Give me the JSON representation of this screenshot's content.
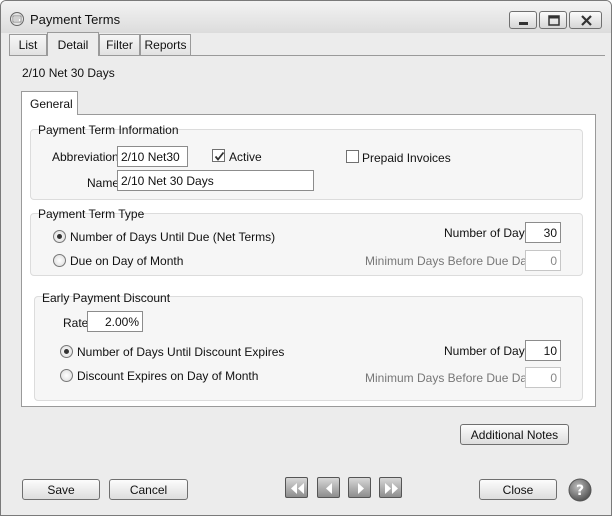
{
  "window": {
    "title": "Payment Terms"
  },
  "tabs": [
    {
      "label": "List"
    },
    {
      "label": "Detail"
    },
    {
      "label": "Filter"
    },
    {
      "label": "Reports"
    }
  ],
  "record_title": "2/10 Net 30 Days",
  "inner_tabs": [
    {
      "label": "General"
    }
  ],
  "payment_term_information": {
    "title": "Payment Term Information",
    "abbreviation_label": "Abbreviation",
    "abbreviation_value": "2/10 Net30",
    "active_label": "Active",
    "active_checked": true,
    "prepaid_label": "Prepaid Invoices",
    "prepaid_checked": false,
    "name_label": "Name",
    "name_value": "2/10 Net 30 Days"
  },
  "payment_term_type": {
    "title": "Payment Term Type",
    "option_net_terms": "Number of Days Until Due (Net Terms)",
    "option_day_of_month": "Due on Day of Month",
    "selected": "net_terms",
    "number_of_days_label": "Number of Days",
    "number_of_days_value": "30",
    "min_days_label": "Minimum Days Before Due Date",
    "min_days_value": "0"
  },
  "early_payment_discount": {
    "title": "Early Payment Discount",
    "rate_label": "Rate",
    "rate_value": "2.00%",
    "option_days_until_expires": "Number of Days Until Discount Expires",
    "option_day_of_month": "Discount Expires on Day of Month",
    "selected": "days_until_expires",
    "number_of_days_label": "Number of Days",
    "number_of_days_value": "10",
    "min_days_label": "Minimum Days Before Due Date",
    "min_days_value": "0"
  },
  "buttons": {
    "additional_notes": "Additional Notes",
    "save": "Save",
    "cancel": "Cancel",
    "close": "Close"
  },
  "navigation": {
    "icons": [
      "first-record-icon",
      "previous-record-icon",
      "next-record-icon",
      "last-record-icon"
    ]
  },
  "colors": {
    "window_bg": "#ececec",
    "panel_bg": "#ffffff",
    "group_bg": "#f6f6f6"
  }
}
